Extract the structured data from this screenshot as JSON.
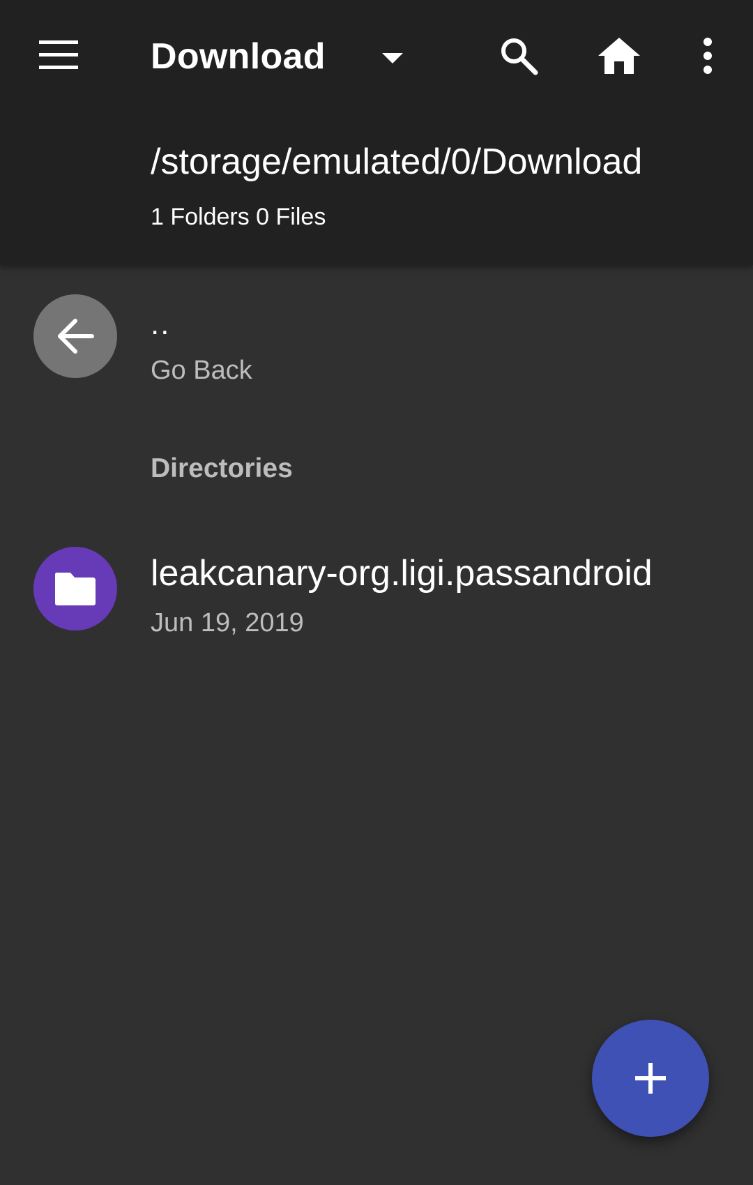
{
  "toolbar": {
    "title": "Download",
    "menu_icon": "hamburger-menu-icon",
    "dropdown_icon": "arrow-drop-down-icon",
    "search_icon": "search-icon",
    "home_icon": "home-icon",
    "more_icon": "more-vertical-icon"
  },
  "header": {
    "path": "/storage/emulated/0/Download",
    "counts": "1 Folders 0 Files"
  },
  "back_item": {
    "icon": "arrow-back-icon",
    "label": "..",
    "sublabel": "Go Back"
  },
  "sections": {
    "directories_label": "Directories"
  },
  "folders": [
    {
      "name": "leakcanary-org.ligi.passandroid",
      "date": "Jun 19, 2019",
      "icon": "folder-icon"
    }
  ],
  "fab": {
    "icon": "plus-icon"
  },
  "colors": {
    "toolbar_bg": "#212121",
    "content_bg": "#303030",
    "back_avatar": "#757575",
    "folder_avatar": "#673ab7",
    "fab": "#3f51b5",
    "secondary_text": "#bdbdbd"
  }
}
